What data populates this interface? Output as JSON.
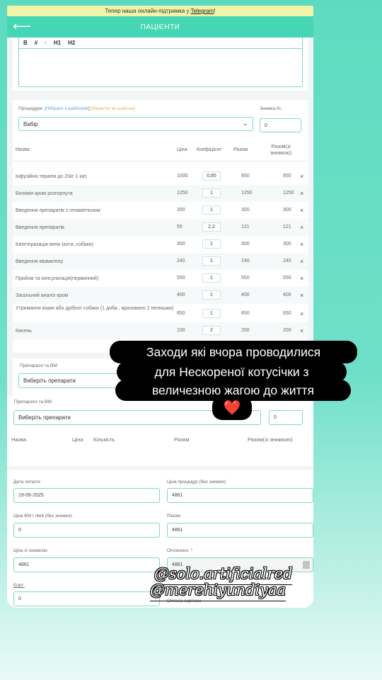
{
  "banner": {
    "text": "Тепер наша онлайн-підтримка у",
    "link": "Telegram",
    "suffix": "!"
  },
  "appbar": {
    "title": "ПАЦІЄНТИ",
    "back_icon": "arrow-left-icon"
  },
  "editor": {
    "tools": [
      "B",
      "#",
      "·",
      "H1",
      "H2"
    ]
  },
  "procedures": {
    "label": "Процедури:",
    "hint_template": "[Нібірате з шаблонів]",
    "hint_save": "[Зберегти як шаблон]",
    "discount_label": "Знижка,%:",
    "select_value": "Вибір",
    "discount_value": "0",
    "columns": [
      "Назва",
      "Ціна",
      "Коефіцієнт",
      "Разом",
      "Разом(зі знижкою)"
    ],
    "rows": [
      {
        "name": "Інфузійна терапія до 20кг 1 кат.",
        "price": "1000",
        "coef": "0,85",
        "total": "850",
        "total_disc": "850"
      },
      {
        "name": "Біохімія крові розгорнута",
        "price": "1250",
        "coef": "1",
        "total": "1250",
        "total_disc": "1250"
      },
      {
        "name": "Введення препаратів з гепаметіоном",
        "price": "300",
        "coef": "1",
        "total": "300",
        "total_disc": "300"
      },
      {
        "name": "Введення препаратів",
        "price": "55",
        "coef": "2,2",
        "total": "121",
        "total_disc": "121"
      },
      {
        "name": "Катетеризація вени (коти, собаки)",
        "price": "300",
        "coef": "1",
        "total": "300",
        "total_disc": "300"
      },
      {
        "name": "Введення квамателу",
        "price": "240",
        "coef": "1",
        "total": "240",
        "total_disc": "240"
      },
      {
        "name": "Прийом та консультація(первинний)",
        "price": "550",
        "coef": "1",
        "total": "550",
        "total_disc": "550"
      },
      {
        "name": "Загальний аналіз крові",
        "price": "400",
        "coef": "1",
        "total": "400",
        "total_disc": "400"
      },
      {
        "name": "Утримання кішки або дрібної собаки (1 доба , враховано 2 пелюшки)",
        "price": "650",
        "coef": "1",
        "total": "650",
        "total_disc": "650"
      },
      {
        "name": "Кисень",
        "price": "100",
        "coef": "2",
        "total": "200",
        "total_disc": "200"
      }
    ],
    "remove_icon": "close-icon"
  },
  "vm": {
    "label1": "Препарати та ВМ:",
    "select1": "Виберіть препарати",
    "label2": "Препарати та ВМ:",
    "select2": "Виберіть препарати",
    "qty_value": "0",
    "columns": [
      "Назва",
      "Ціна",
      "Кількість",
      "Разом",
      "Разом(зі знижкою)"
    ]
  },
  "totals": {
    "pay_date_label": "Дата оплати:",
    "pay_date": "19-06-2025",
    "proc_price_label": "Ціна процедур (без знижки):",
    "proc_price": "4861",
    "vm_price_label": "Ціна ВМ і ліків (без знижки):",
    "vm_price": "0",
    "total_label": "Разом:",
    "total": "4861",
    "disc_price_label": "Ціна зі знижкою:",
    "disc_price": "4861",
    "paid_label": "Оплачено:",
    "paid_req": "*",
    "paid": "4861",
    "debt_label": "Борг:",
    "debt": "0",
    "card_label": "Оплата карткою"
  },
  "overlay": {
    "caption": [
      "Заходи які вчора проводилися",
      "для Нескореної котусічки з",
      "величезною жагою до життя"
    ],
    "heart": "❤️",
    "handles": [
      "@solo.artificialred",
      "@merehiyundiyaa"
    ]
  }
}
